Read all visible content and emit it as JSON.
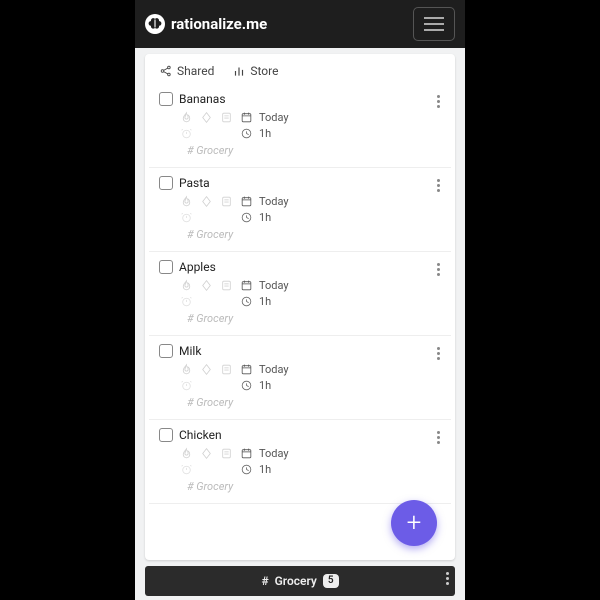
{
  "header": {
    "brand": "rationalize.me"
  },
  "tabs": {
    "shared": "Shared",
    "store": "Store"
  },
  "tasks": [
    {
      "title": "Bananas",
      "date": "Today",
      "duration": "1h",
      "tag": "# Grocery"
    },
    {
      "title": "Pasta",
      "date": "Today",
      "duration": "1h",
      "tag": "# Grocery"
    },
    {
      "title": "Apples",
      "date": "Today",
      "duration": "1h",
      "tag": "# Grocery"
    },
    {
      "title": "Milk",
      "date": "Today",
      "duration": "1h",
      "tag": "# Grocery"
    },
    {
      "title": "Chicken",
      "date": "Today",
      "duration": "1h",
      "tag": "# Grocery"
    }
  ],
  "fab": {
    "label": "+"
  },
  "bottom": {
    "hash": "#",
    "tag": "Grocery",
    "count": "5"
  }
}
